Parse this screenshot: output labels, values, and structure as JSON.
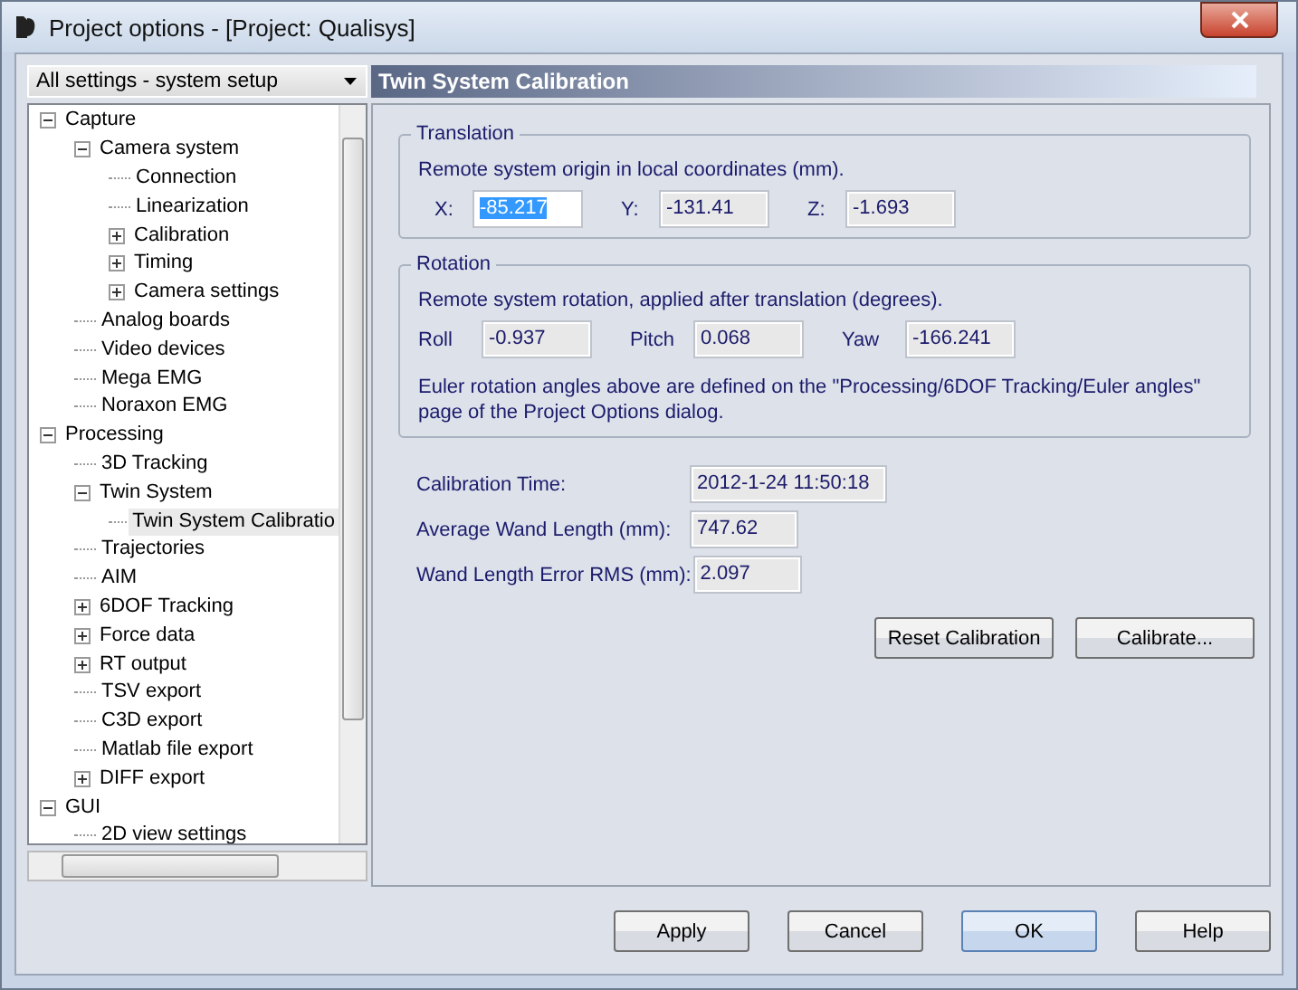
{
  "window": {
    "title": "Project options - [Project: Qualisys]"
  },
  "view_selector": {
    "value": "All settings - system setup"
  },
  "tree": [
    {
      "label": "Capture",
      "expanded": true,
      "selected": false,
      "children": [
        {
          "label": "Camera system",
          "expanded": true,
          "selected": false,
          "children": [
            {
              "label": "Connection",
              "selected": false
            },
            {
              "label": "Linearization",
              "selected": false
            },
            {
              "label": "Calibration",
              "expanded": false,
              "selected": false
            },
            {
              "label": "Timing",
              "expanded": false,
              "selected": false
            },
            {
              "label": "Camera settings",
              "expanded": false,
              "selected": false
            }
          ]
        },
        {
          "label": "Analog boards",
          "selected": false
        },
        {
          "label": "Video devices",
          "selected": false
        },
        {
          "label": "Mega EMG",
          "selected": false
        },
        {
          "label": "Noraxon EMG",
          "selected": false
        }
      ]
    },
    {
      "label": "Processing",
      "expanded": true,
      "selected": false,
      "children": [
        {
          "label": "3D Tracking",
          "selected": false
        },
        {
          "label": "Twin System",
          "expanded": true,
          "selected": false,
          "children": [
            {
              "label": "Twin System Calibratio",
              "selected": true
            }
          ]
        },
        {
          "label": "Trajectories",
          "selected": false
        },
        {
          "label": "AIM",
          "selected": false
        },
        {
          "label": "6DOF Tracking",
          "expanded": false,
          "selected": false
        },
        {
          "label": "Force data",
          "expanded": false,
          "selected": false
        },
        {
          "label": "RT output",
          "expanded": false,
          "selected": false
        },
        {
          "label": "TSV export",
          "selected": false
        },
        {
          "label": "C3D export",
          "selected": false
        },
        {
          "label": "Matlab file export",
          "selected": false
        },
        {
          "label": "DIFF export",
          "expanded": false,
          "selected": false
        }
      ]
    },
    {
      "label": "GUI",
      "expanded": true,
      "selected": false,
      "children": [
        {
          "label": "2D view settings",
          "selected": false
        }
      ]
    }
  ],
  "page_title": "Twin System Calibration",
  "translation": {
    "title": "Translation",
    "description": "Remote system origin in local coordinates (mm).",
    "fields": [
      {
        "label": "X:",
        "value": "-85.217",
        "selected": true
      },
      {
        "label": "Y:",
        "value": "-131.41",
        "selected": false
      },
      {
        "label": "Z:",
        "value": "-1.693",
        "selected": false
      }
    ]
  },
  "rotation": {
    "title": "Rotation",
    "description": "Remote system rotation, applied after translation (degrees).",
    "fields": [
      {
        "label": "Roll",
        "value": "-0.937",
        "selected": false
      },
      {
        "label": "Pitch",
        "value": "0.068",
        "selected": false
      },
      {
        "label": "Yaw",
        "value": "-166.241",
        "selected": false
      }
    ],
    "note": "Euler rotation angles above are defined on the \"Processing/6DOF Tracking/Euler angles\" page of the Project Options dialog."
  },
  "results": [
    {
      "label": "Calibration Time:",
      "value": "2012-1-24 11:50:18"
    },
    {
      "label": "Average Wand Length (mm):",
      "value": "747.62"
    },
    {
      "label": "Wand Length Error RMS (mm):",
      "value": "2.097"
    }
  ],
  "panel_buttons": [
    "Reset Calibration",
    "Calibrate..."
  ],
  "dialog_buttons": [
    {
      "label": "Apply",
      "default": false
    },
    {
      "label": "Cancel",
      "default": false
    },
    {
      "label": "OK",
      "default": true
    },
    {
      "label": "Help",
      "default": false
    }
  ]
}
